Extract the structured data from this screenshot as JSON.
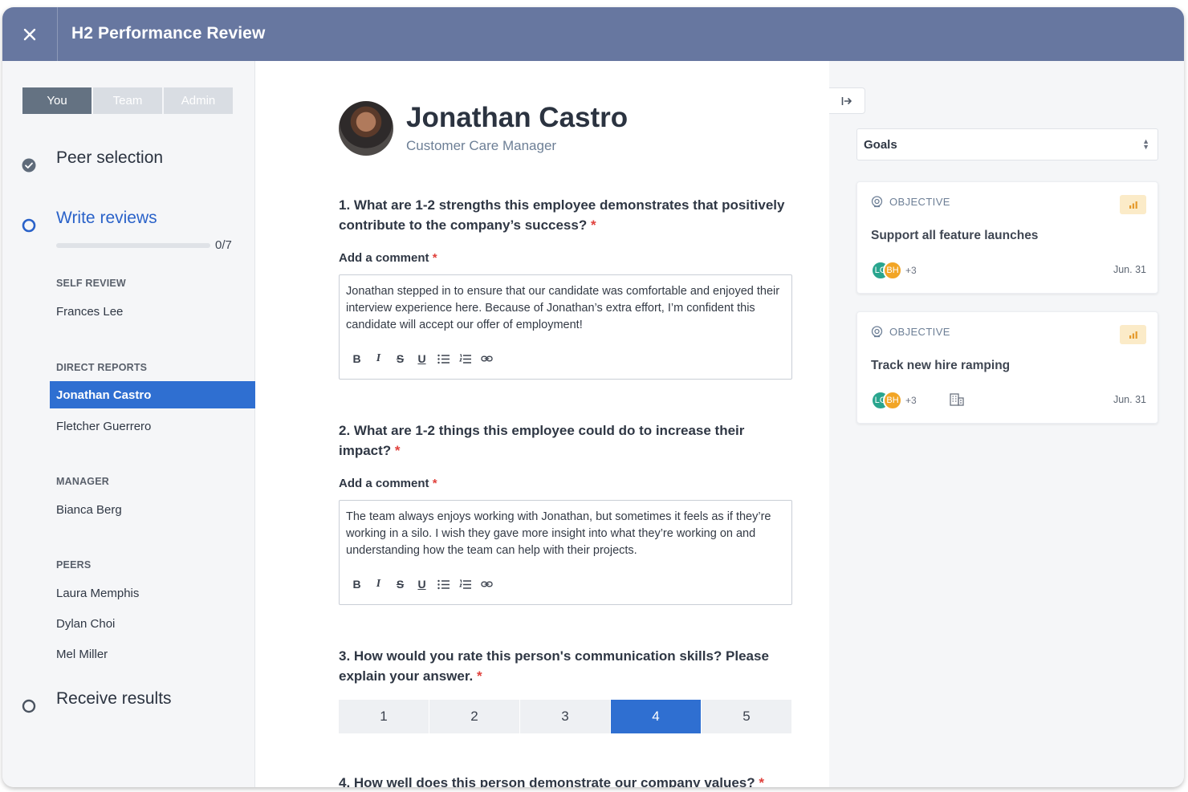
{
  "header": {
    "title": "H2 Performance Review",
    "close_icon": "close-icon"
  },
  "tabs": [
    {
      "label": "You",
      "active": true
    },
    {
      "label": "Team",
      "active": false
    },
    {
      "label": "Admin",
      "active": false
    }
  ],
  "steps": {
    "peer_selection": "Peer selection",
    "write_reviews": "Write reviews",
    "receive_results": "Receive results"
  },
  "progress": {
    "count": "0/7",
    "fraction": 0
  },
  "groups": {
    "self_review": {
      "label": "SELF REVIEW",
      "people": [
        "Frances Lee"
      ]
    },
    "direct_reports": {
      "label": "DIRECT REPORTS",
      "people": [
        "Jonathan Castro",
        "Fletcher Guerrero"
      ],
      "selected": "Jonathan Castro"
    },
    "manager": {
      "label": "MANAGER",
      "people": [
        "Bianca Berg"
      ]
    },
    "peers": {
      "label": "PEERS",
      "people": [
        "Laura Memphis",
        "Dylan Choi",
        "Mel Miller"
      ]
    }
  },
  "employee": {
    "name": "Jonathan Castro",
    "role": "Customer Care Manager"
  },
  "questions": [
    {
      "text": "1. What are 1-2 strengths this employee demonstrates that positively contribute to the company’s success?",
      "comment_label": "Add a comment",
      "comment": "Jonathan stepped in to ensure that our candidate was comfortable and enjoyed their interview experience here. Because of Jonathan’s extra effort, I’m confident this candidate will accept our offer of employment!"
    },
    {
      "text": "2. What are 1-2 things this employee could do to increase their impact?",
      "comment_label": "Add a comment",
      "comment": "The team always enjoys working with Jonathan, but sometimes it feels as if they’re working in a silo. I wish they gave more insight into what they’re working on and understanding how the team can help with their projects."
    },
    {
      "text": "3. How would you rate this person's communication skills? Please explain your answer.",
      "rating_options": [
        "1",
        "2",
        "3",
        "4",
        "5"
      ],
      "selected": "4"
    },
    {
      "text": "4. How well does this person demonstrate our company values?"
    }
  ],
  "required_marker": "*",
  "toolbar": {
    "bold": "B",
    "italic": "I",
    "strike": "S",
    "underline": "U"
  },
  "right_panel": {
    "select_value": "Goals",
    "goals": [
      {
        "type": "OBJECTIVE",
        "title": "Support all feature launches",
        "avatars": [
          "LG",
          "BH"
        ],
        "more": "+3",
        "date": "Jun. 31"
      },
      {
        "type": "OBJECTIVE",
        "title": "Track new hire ramping",
        "avatars": [
          "LG",
          "BH"
        ],
        "more": "+3",
        "date": "Jun. 31"
      }
    ]
  },
  "colors": {
    "header": "#6777a0",
    "accent": "#2f6fd1",
    "required": "#e0413c"
  }
}
